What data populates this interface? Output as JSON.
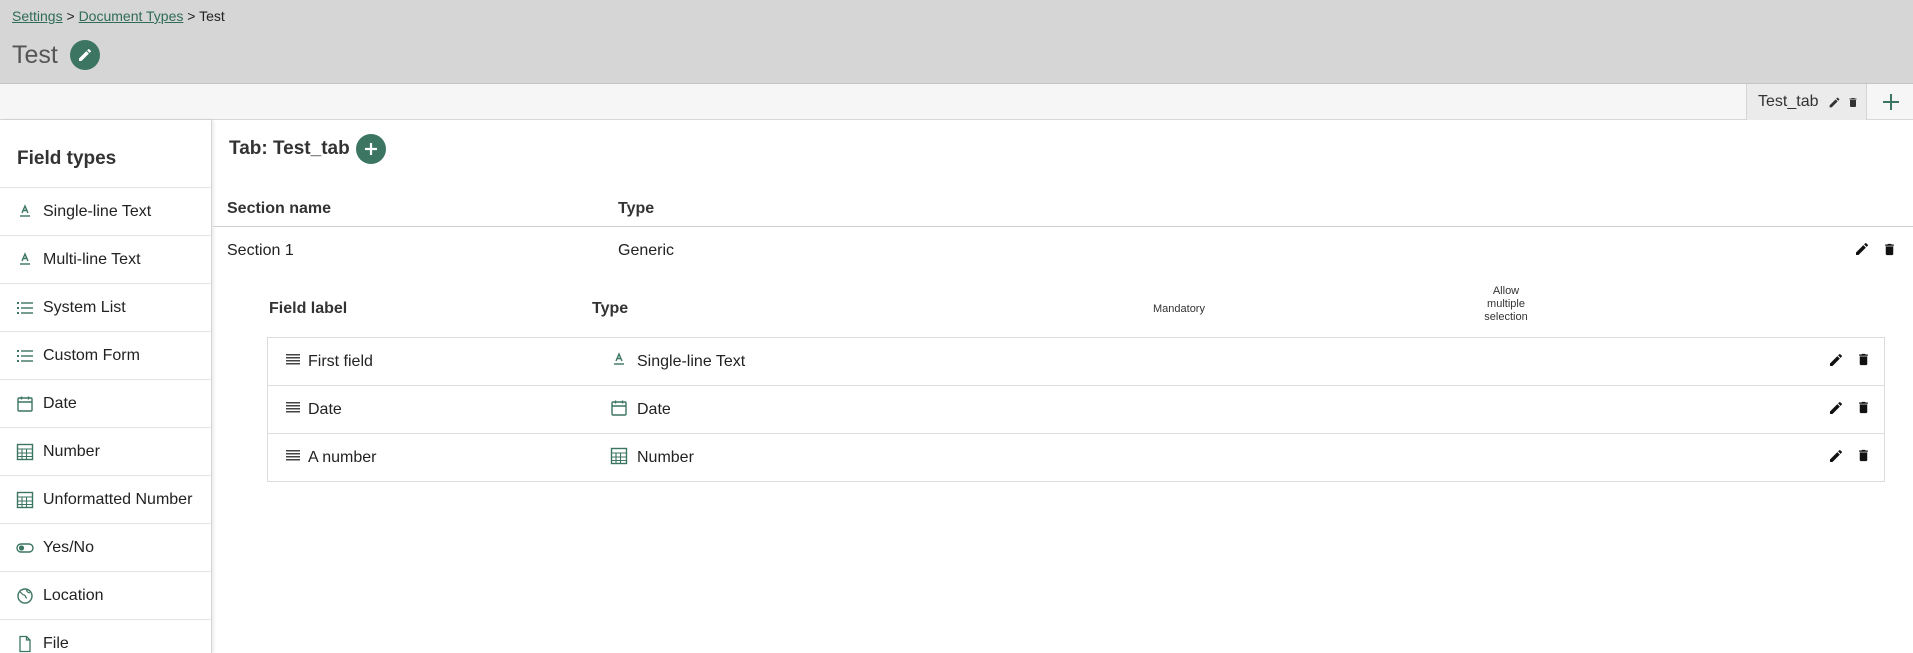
{
  "breadcrumb": {
    "settings": "Settings",
    "sep1": ">",
    "document_types": "Document Types",
    "sep2": ">",
    "current": "Test"
  },
  "page": {
    "title": "Test"
  },
  "tabs": [
    {
      "label": "Test_tab"
    }
  ],
  "sidebar": {
    "title": "Field types",
    "items": [
      {
        "label": "Single-line Text",
        "icon": "text-icon"
      },
      {
        "label": "Multi-line Text",
        "icon": "text-icon"
      },
      {
        "label": "System List",
        "icon": "list-icon"
      },
      {
        "label": "Custom Form",
        "icon": "list-icon"
      },
      {
        "label": "Date",
        "icon": "calendar-icon"
      },
      {
        "label": "Number",
        "icon": "calculator-icon"
      },
      {
        "label": "Unformatted Number",
        "icon": "calculator-icon"
      },
      {
        "label": "Yes/No",
        "icon": "toggle-icon"
      },
      {
        "label": "Location",
        "icon": "globe-icon"
      },
      {
        "label": "File",
        "icon": "file-icon"
      }
    ]
  },
  "main": {
    "tab_heading": "Tab: Test_tab",
    "section_header": {
      "name": "Section name",
      "type": "Type"
    },
    "sections": [
      {
        "name": "Section 1",
        "type": "Generic"
      }
    ],
    "field_header": {
      "label": "Field label",
      "type": "Type",
      "mandatory": "Mandatory",
      "allow_1": "Allow",
      "allow_2": "multiple",
      "allow_3": "selection"
    },
    "fields": [
      {
        "label": "First field",
        "type": "Single-line Text",
        "icon": "text-icon"
      },
      {
        "label": "Date",
        "type": "Date",
        "icon": "calendar-icon"
      },
      {
        "label": "A number",
        "type": "Number",
        "icon": "calculator-icon"
      }
    ]
  },
  "colors": {
    "accent": "#3c7561",
    "header_bg": "#d6d6d6",
    "link": "#2f6b58"
  }
}
